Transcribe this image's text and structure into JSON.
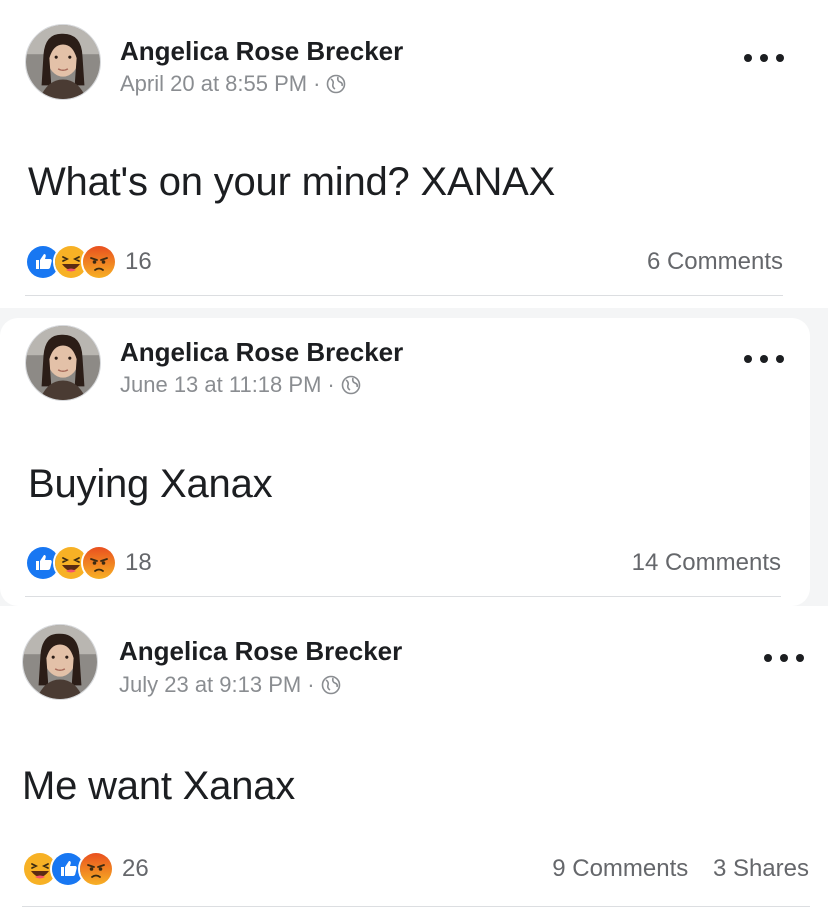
{
  "posts": [
    {
      "author": "Angelica Rose Brecker",
      "timestamp": "April 20 at 8:55 PM",
      "separator": "·",
      "audience_icon": "globe-icon",
      "text": "What's on your mind? XANAX",
      "reactions": [
        "like",
        "haha",
        "angry"
      ],
      "reaction_count": "16",
      "comments": "6 Comments",
      "shares": ""
    },
    {
      "author": "Angelica Rose Brecker",
      "timestamp": "June 13 at 11:18 PM",
      "separator": "·",
      "audience_icon": "globe-icon",
      "text": "Buying Xanax",
      "reactions": [
        "like",
        "haha",
        "angry"
      ],
      "reaction_count": "18",
      "comments": "14 Comments",
      "shares": ""
    },
    {
      "author": "Angelica Rose Brecker",
      "timestamp": "July 23 at 9:13 PM",
      "separator": "·",
      "audience_icon": "globe-icon",
      "text": "Me want Xanax",
      "reactions": [
        "haha",
        "like",
        "angry"
      ],
      "reaction_count": "26",
      "comments": "9 Comments",
      "shares": "3 Shares"
    }
  ],
  "colors": {
    "like": "#1877f2",
    "haha": "#f7b125",
    "angry": "#e9710f",
    "meta_text": "#8a8d91",
    "divider": "#dcdee1"
  }
}
